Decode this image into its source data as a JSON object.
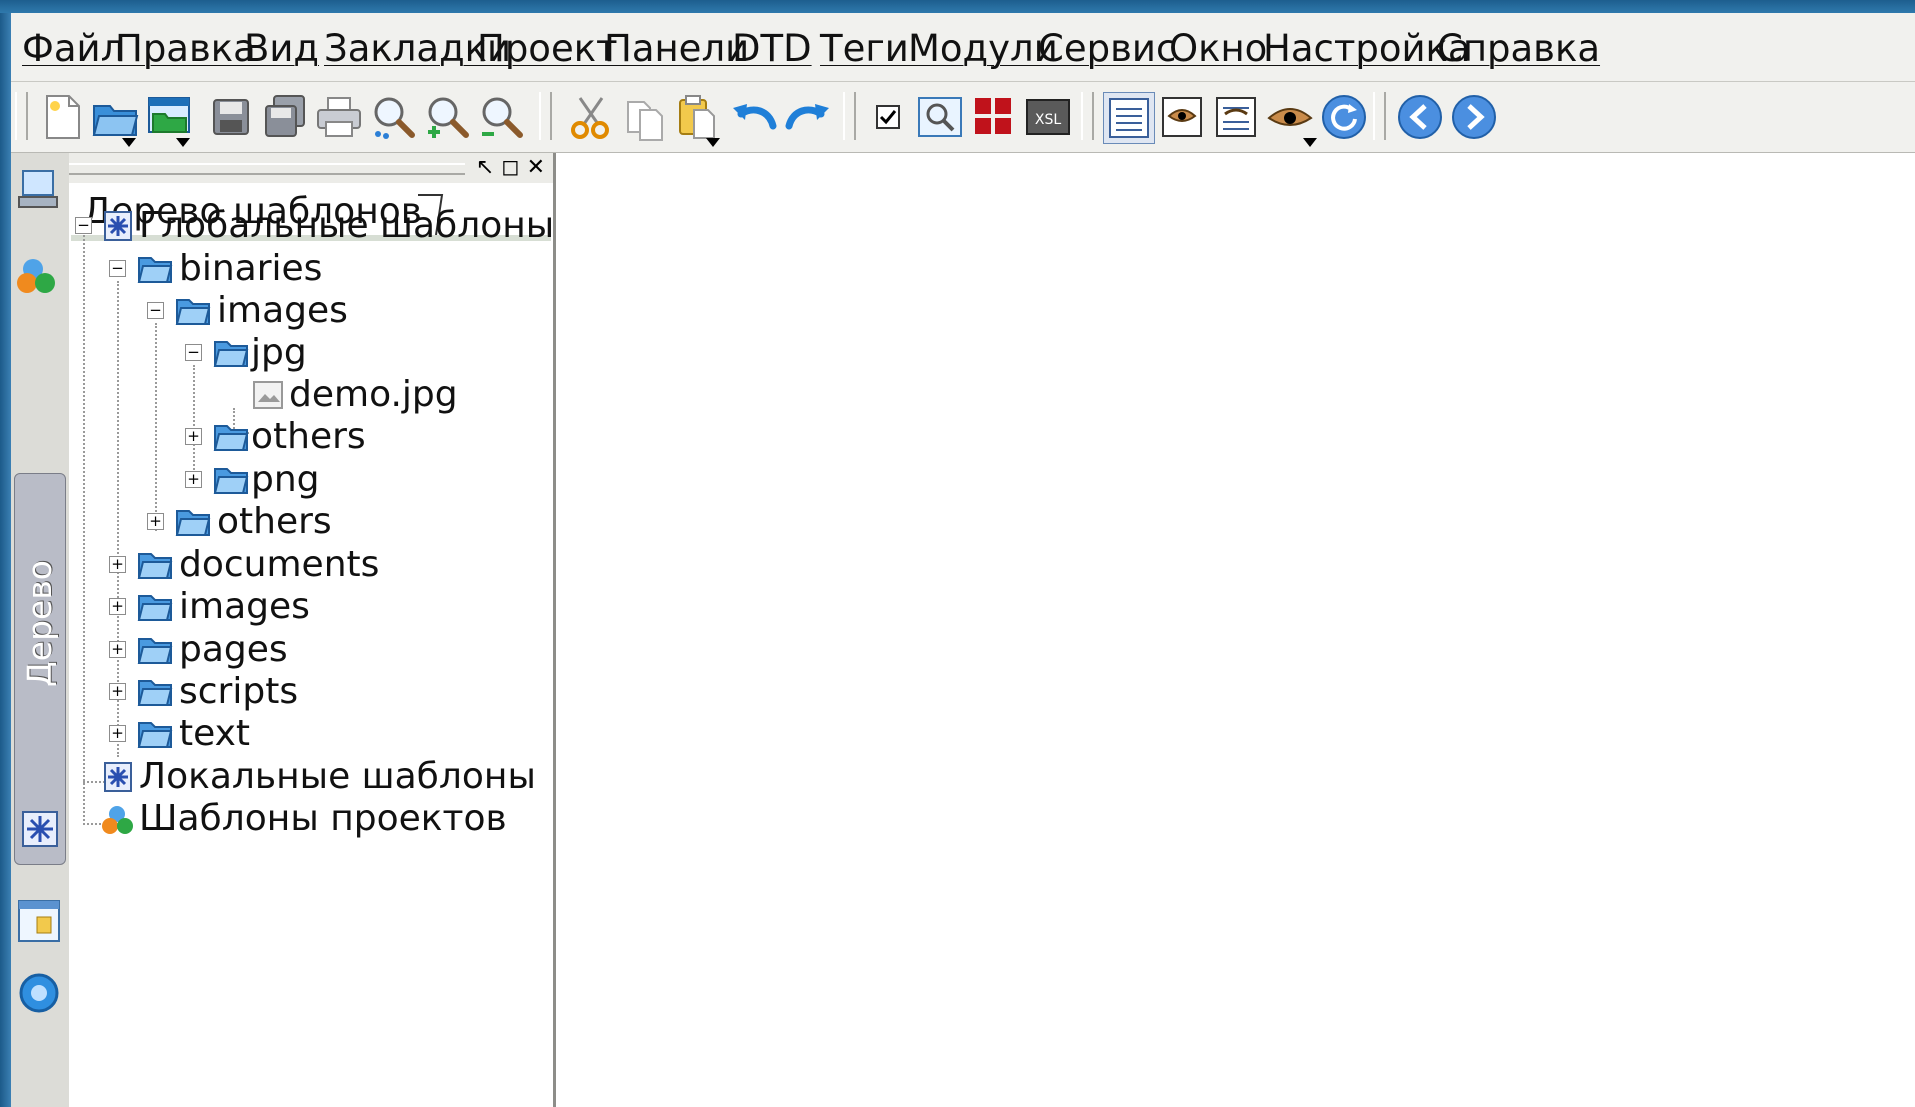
{
  "menubar": {
    "items": [
      "Файл",
      "Правка",
      "Вид",
      "Закладки",
      "Проект",
      "Панели",
      "DTD",
      "Теги",
      "Модули",
      "Сервис",
      "Окно",
      "Настройка",
      "Справка"
    ]
  },
  "toolbar": {
    "icons": [
      "new-file-icon",
      "open-folder-icon",
      "open-project-icon",
      "save-icon",
      "save-all-icon",
      "print-icon",
      "find-icon",
      "zoom-in-icon",
      "zoom-out-icon",
      "cut-icon",
      "copy-icon",
      "paste-icon",
      "undo-icon",
      "redo-icon",
      "checkbox-icon",
      "preview-search-icon",
      "plugin-blocks-icon",
      "xsl-icon",
      "list-view-icon",
      "eye-preview-icon",
      "edit-preview-icon",
      "eye-dropdown-icon",
      "reload-icon",
      "back-icon",
      "forward-icon"
    ],
    "xsl_label": "XSL"
  },
  "sidebar": {
    "vertical_tab_label": "Дерево шаблонов"
  },
  "panel": {
    "tab_title": "Дерево шаблонов",
    "ctrls": [
      "↖",
      "◻",
      "✕"
    ]
  },
  "tree": {
    "global": "Глобальные шаблоны",
    "binaries": "binaries",
    "images1": "images",
    "jpg": "jpg",
    "demo": "demo.jpg",
    "others1": "others",
    "png": "png",
    "others2": "others",
    "documents": "documents",
    "images2": "images",
    "pages": "pages",
    "scripts": "scripts",
    "text": "text",
    "local": "Локальные шаблоны",
    "projects": "Шаблоны проектов"
  }
}
